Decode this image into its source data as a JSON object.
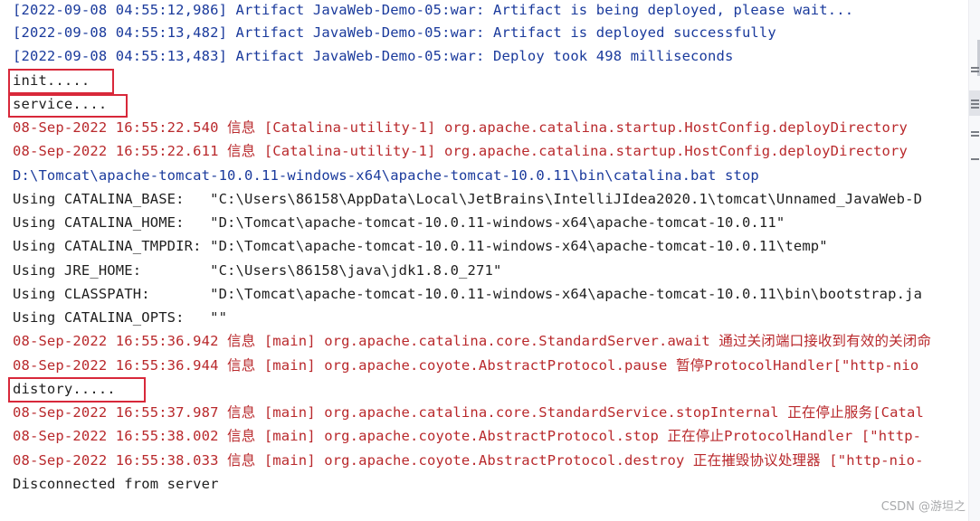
{
  "console": {
    "lines": [
      {
        "text": "[2022-09-08 04:55:12,986] Artifact JavaWeb-Demo-05:war: Artifact is being deployed, please wait...",
        "color": "#1a3a9c"
      },
      {
        "text": "[2022-09-08 04:55:13,482] Artifact JavaWeb-Demo-05:war: Artifact is deployed successfully",
        "color": "#1a3a9c"
      },
      {
        "text": "[2022-09-08 04:55:13,483] Artifact JavaWeb-Demo-05:war: Deploy took 498 milliseconds",
        "color": "#1a3a9c"
      },
      {
        "text": "init.....",
        "color": "#1f1f1f"
      },
      {
        "text": "service....",
        "color": "#1f1f1f"
      },
      {
        "text": "08-Sep-2022 16:55:22.540 信息 [Catalina-utility-1] org.apache.catalina.startup.HostConfig.deployDirectory ",
        "color": "#b9292c"
      },
      {
        "text": "08-Sep-2022 16:55:22.611 信息 [Catalina-utility-1] org.apache.catalina.startup.HostConfig.deployDirectory ",
        "color": "#b9292c"
      },
      {
        "text": "D:\\Tomcat\\apache-tomcat-10.0.11-windows-x64\\apache-tomcat-10.0.11\\bin\\catalina.bat stop",
        "color": "#1a3a9c"
      },
      {
        "text": "Using CATALINA_BASE:   \"C:\\Users\\86158\\AppData\\Local\\JetBrains\\IntelliJIdea2020.1\\tomcat\\Unnamed_JavaWeb-D",
        "color": "#1f1f1f"
      },
      {
        "text": "Using CATALINA_HOME:   \"D:\\Tomcat\\apache-tomcat-10.0.11-windows-x64\\apache-tomcat-10.0.11\"",
        "color": "#1f1f1f"
      },
      {
        "text": "Using CATALINA_TMPDIR: \"D:\\Tomcat\\apache-tomcat-10.0.11-windows-x64\\apache-tomcat-10.0.11\\temp\"",
        "color": "#1f1f1f"
      },
      {
        "text": "Using JRE_HOME:        \"C:\\Users\\86158\\java\\jdk1.8.0_271\"",
        "color": "#1f1f1f"
      },
      {
        "text": "Using CLASSPATH:       \"D:\\Tomcat\\apache-tomcat-10.0.11-windows-x64\\apache-tomcat-10.0.11\\bin\\bootstrap.ja",
        "color": "#1f1f1f"
      },
      {
        "text": "Using CATALINA_OPTS:   \"\"",
        "color": "#1f1f1f"
      },
      {
        "text": "08-Sep-2022 16:55:36.942 信息 [main] org.apache.catalina.core.StandardServer.await 通过关闭端口接收到有效的关闭命",
        "color": "#b9292c"
      },
      {
        "text": "08-Sep-2022 16:55:36.944 信息 [main] org.apache.coyote.AbstractProtocol.pause 暂停ProtocolHandler[\"http-nio",
        "color": "#b9292c"
      },
      {
        "text": "distory.....",
        "color": "#1f1f1f"
      },
      {
        "text": "08-Sep-2022 16:55:37.987 信息 [main] org.apache.catalina.core.StandardService.stopInternal 正在停止服务[Catal",
        "color": "#b9292c"
      },
      {
        "text": "08-Sep-2022 16:55:38.002 信息 [main] org.apache.coyote.AbstractProtocol.stop 正在停止ProtocolHandler [\"http-",
        "color": "#b9292c"
      },
      {
        "text": "08-Sep-2022 16:55:38.033 信息 [main] org.apache.coyote.AbstractProtocol.destroy 正在摧毁协议处理器 [\"http-nio-",
        "color": "#b9292c"
      },
      {
        "text": "Disconnected from server",
        "color": "#1f1f1f"
      }
    ]
  },
  "highlights": {
    "init": "init.....",
    "service": "service....",
    "distory": "distory....."
  },
  "watermark": "CSDN @游坦之",
  "colors": {
    "info_blue": "#1a3a9c",
    "log_red": "#b9292c",
    "plain": "#1f1f1f",
    "highlight_border": "#d8283a"
  },
  "gutter_icons": [
    "wrap-icon",
    "scroll-to-end-icon",
    "print-icon",
    "clear-icon"
  ]
}
